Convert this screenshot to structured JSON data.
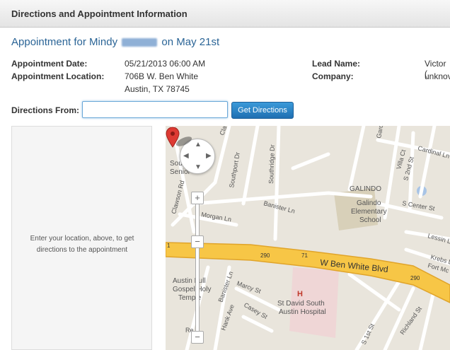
{
  "window": {
    "title": "Directions and Appointment Information"
  },
  "heading": {
    "prefix": "Appointment for Mindy",
    "suffix": "on May 21st"
  },
  "details": {
    "date_label": "Appointment Date:",
    "date_value": "05/21/2013 06:00 AM",
    "location_label": "Appointment Location:",
    "address_line1": "706B W. Ben White",
    "address_line2": "Austin, TX 78745",
    "lead_label": "Lead Name:",
    "lead_value": "Victor (",
    "company_label": "Company:",
    "company_value": "unknov"
  },
  "directions": {
    "label": "Directions From:",
    "input_value": "",
    "button_label": "Get Directions"
  },
  "panel": {
    "message": "Enter your location, above, to get directions to the appointment"
  },
  "map": {
    "labels": {
      "south_austin_1": "South Austin",
      "south_austin_2": "Senior",
      "clawson_rd": "Clawson Rd",
      "southport_dr": "Southport Dr",
      "southridge_dr": "Southridge Dr",
      "galindo": "GALINDO",
      "galindo_school_1": "Galindo",
      "galindo_school_2": "Elementary",
      "galindo_school_3": "School",
      "morgan_ln": "Morgan Ln",
      "banister_ln_top": "Banister Ln",
      "banister_ln_bottom": "Banister Ln",
      "w_ben_white": "W Ben White Blvd",
      "hwy_290_left": "290",
      "hwy_71": "71",
      "hwy_290_right": "290",
      "hwy_1": "1",
      "austin_full_1": "Austin Full",
      "austin_full_2": "Gospel Holy",
      "austin_full_3": "Temple",
      "marcy_st": "Marcy St",
      "casey_st": "Casey St",
      "hank_ave": "Hank Ave",
      "st_david_1": "St David South",
      "st_david_2": "Austin Hospital",
      "s_1st_st": "S 1st St",
      "richland_st": "Richland St",
      "cardinal_ln": "Cardinal Ln",
      "s_center_st": "S Center St",
      "s_2nd_st": "S 2nd St",
      "villa_ct": "Villa Ct",
      "garden": "Garden",
      "lessin_ln": "Lessin Ln",
      "krebs_ln": "Krebs L",
      "fort_mc": "Fort Mc G",
      "reese": "Re",
      "claw_top": "Claw",
      "hospital_h": "H"
    },
    "colors": {
      "land": "#e9e5dc",
      "highway": "#f7c646",
      "highway_edge": "#e0a42a",
      "road": "#ffffff",
      "park": "#d8d0b9",
      "hospital": "#efd6d6",
      "marker": "#dd3a33"
    }
  }
}
